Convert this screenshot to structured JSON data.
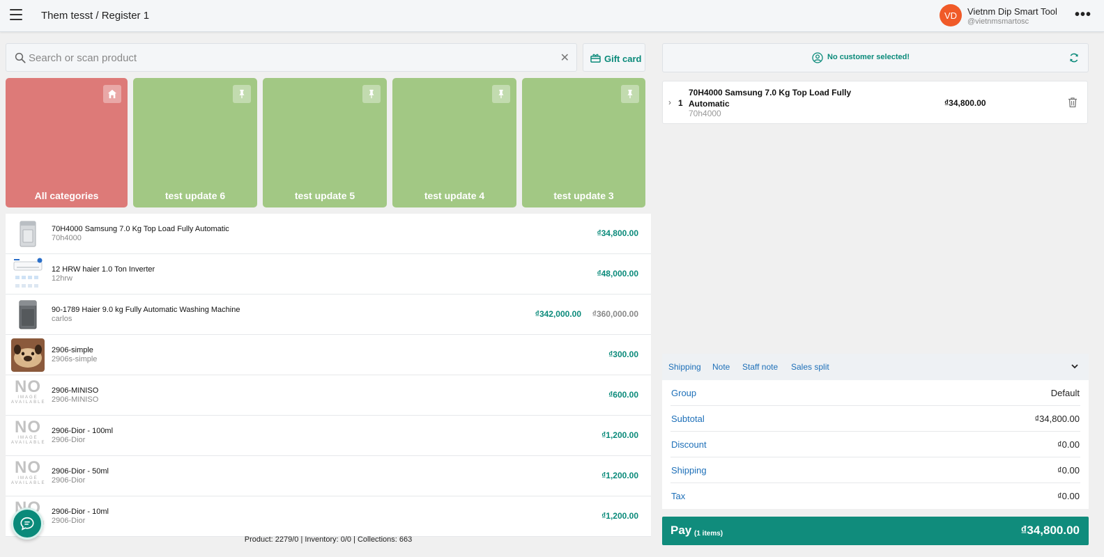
{
  "header": {
    "breadcrumb": "Them tesst / Register 1",
    "user": {
      "initials": "VD",
      "name": "Vietnm Dip Smart Tool",
      "handle": "@vietnmsmartosc"
    }
  },
  "search": {
    "placeholder": "Search or scan product",
    "value": ""
  },
  "gift_card": {
    "label": "Gift card"
  },
  "categories": [
    {
      "name": "All categories",
      "icon": "home-icon",
      "color": "#dd7a78"
    },
    {
      "name": "test update 6",
      "icon": "pin-icon",
      "color": "#a2c884"
    },
    {
      "name": "test update 5",
      "icon": "pin-icon",
      "color": "#a2c884"
    },
    {
      "name": "test update 4",
      "icon": "pin-icon",
      "color": "#a2c884"
    },
    {
      "name": "test update 3",
      "icon": "pin-icon",
      "color": "#a2c884"
    }
  ],
  "products": [
    {
      "name": "70H4000 Samsung 7.0 Kg Top Load Fully Automatic",
      "sku": "70h4000",
      "price": "₫34,800.00",
      "image": "washer-top-load"
    },
    {
      "name": "12 HRW haier 1.0 Ton Inverter",
      "sku": "12hrw",
      "price": "₫48,000.00",
      "image": "air-conditioner"
    },
    {
      "name": "90-1789 Haier 9.0 kg Fully Automatic Washing Machine",
      "sku": "carlos",
      "price": "₫342,000.00",
      "old_price": "₫360,000.00",
      "image": "washer-dark"
    },
    {
      "name": "2906-simple",
      "sku": "2906s-simple",
      "price": "₫300.00",
      "image": "dog-photo"
    },
    {
      "name": "2906-MINISO",
      "sku": "2906-MINISO",
      "price": "₫600.00",
      "image": "no-image"
    },
    {
      "name": "2906-Dior - 100ml",
      "sku": "2906-Dior",
      "price": "₫1,200.00",
      "image": "no-image"
    },
    {
      "name": "2906-Dior - 50ml",
      "sku": "2906-Dior",
      "price": "₫1,200.00",
      "image": "no-image"
    },
    {
      "name": "2906-Dior - 10ml",
      "sku": "2906-Dior",
      "price": "₫1,200.00",
      "image": "no-image"
    }
  ],
  "no_image": {
    "big": "NO",
    "line1": "IMAGE",
    "line2": "AVAILABLE"
  },
  "footer": {
    "stats": "Product: 2279/0 | Inventory: 0/0 | Collections: 663"
  },
  "customer": {
    "label": "No customer selected!"
  },
  "cart": {
    "items": [
      {
        "qty": "1",
        "name": "70H4000 Samsung 7.0 Kg Top Load Fully Automatic",
        "sku": "70h4000",
        "price": "₫34,800.00"
      }
    ]
  },
  "order_tabs": [
    "Shipping",
    "Note",
    "Staff note",
    "Sales split"
  ],
  "summary": [
    {
      "label": "Group",
      "value": "Default"
    },
    {
      "label": "Subtotal",
      "value": "₫34,800.00"
    },
    {
      "label": "Discount",
      "value": "₫0.00"
    },
    {
      "label": "Shipping",
      "value": "₫0.00"
    },
    {
      "label": "Tax",
      "value": "₫0.00"
    }
  ],
  "pay": {
    "label": "Pay",
    "count": "(1 items)",
    "amount": "₫34,800.00"
  },
  "colors": {
    "accent": "#0a8a7a",
    "link": "#1d6fb8",
    "avatar": "#f05a28",
    "pay": "#108c7c"
  }
}
